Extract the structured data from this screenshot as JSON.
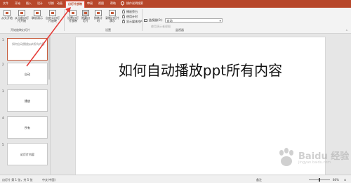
{
  "tabs": [
    "文件",
    "开始",
    "插入",
    "设计",
    "切换",
    "动画",
    "幻灯片放映",
    "审阅",
    "视图",
    "帮助",
    "操作说明搜索"
  ],
  "active_tab": "幻灯片放映",
  "ribbon": {
    "btn_from_start": "从头开始",
    "btn_from_current": "从当前幻灯片开始",
    "btn_online": "联机演示",
    "btn_custom": "自定义幻灯片放映",
    "group_start": "开始放映幻灯片",
    "btn_setup": "设置幻灯片放映",
    "btn_hide": "隐藏幻灯片",
    "btn_rehearse": "排练计时",
    "btn_record": "录制幻灯片演示",
    "chk_narration": "播放旁白",
    "chk_timings": "使用计时",
    "chk_media": "显示媒体控件",
    "group_setup": "设置",
    "monitor_label": "监视器(O):",
    "monitor_value": "自动",
    "presenter_hint": "使用演示者视图",
    "group_monitors": "监视器"
  },
  "slides": [
    {
      "num": "1",
      "text": "如何自动播放ppt所有内容"
    },
    {
      "num": "2",
      "text": "自动"
    },
    {
      "num": "3",
      "text": "播放"
    },
    {
      "num": "4",
      "text": "所有"
    },
    {
      "num": "5",
      "text": "幻灯片内容"
    }
  ],
  "main_slide_title": "如何自动播放ppt所有内容",
  "status": {
    "slide_info": "幻灯片 第 1 张，共 5 张",
    "language": "中文(中国)",
    "notes": "备注",
    "zoom": "86%"
  },
  "watermark": {
    "text": "Baidu 经验",
    "sub": "jingyan.baidu.com"
  },
  "colors": {
    "accent": "#b7472a",
    "annotation": "#e53935"
  }
}
